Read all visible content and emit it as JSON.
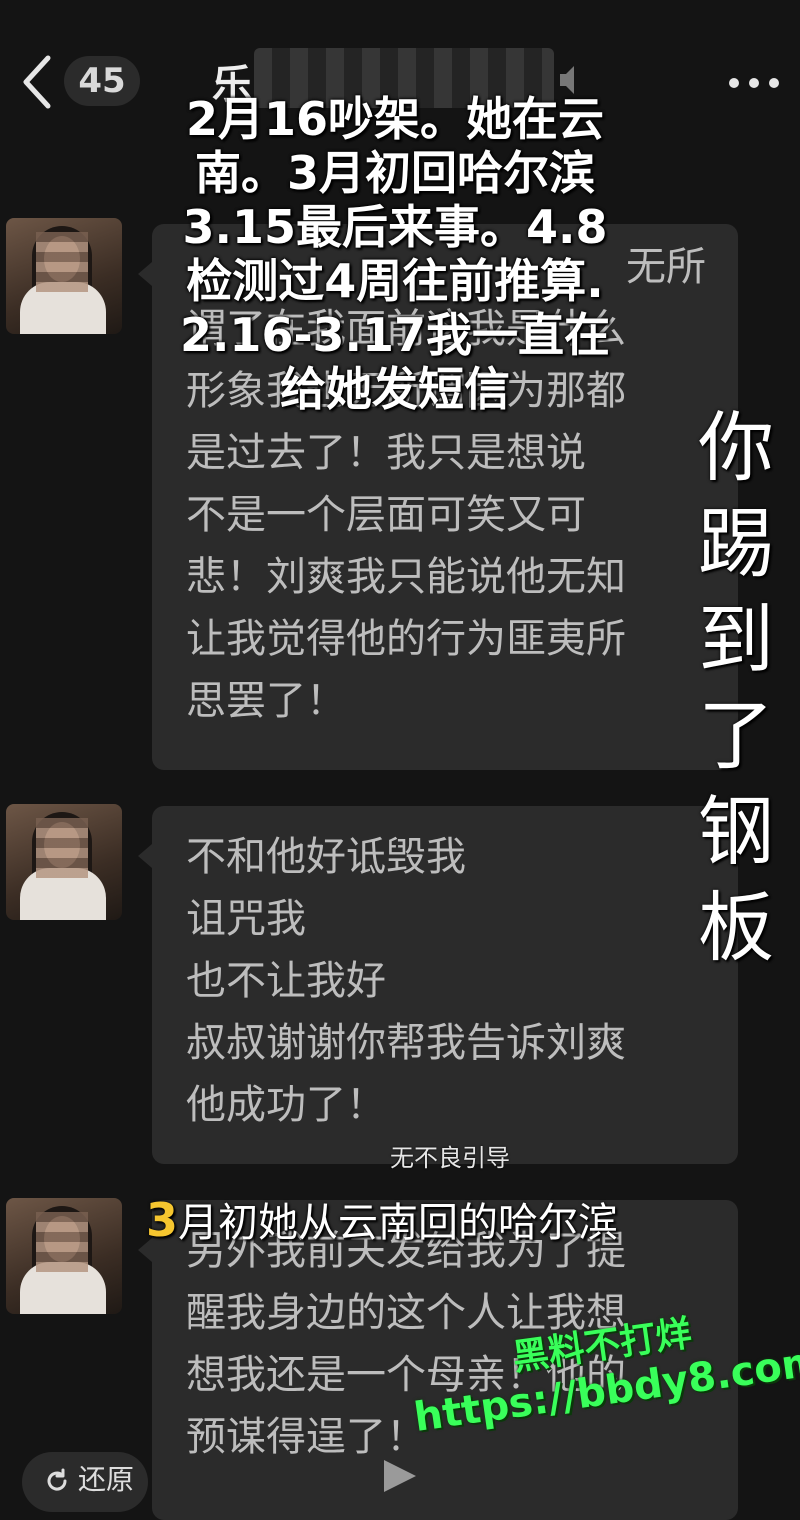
{
  "header": {
    "unread_count": "45",
    "contact_name": "乐"
  },
  "messages": [
    {
      "lines": [
        "",
        "谓了在我面前这我是什么",
        "形象我也无所谓因为那都",
        "是过去了！我只是想说",
        "不是一个层面可笑又可",
        "悲！刘爽我只能说他无知",
        "让我觉得他的行为匪夷所",
        "思罢了！"
      ],
      "partial_line": "无所"
    },
    {
      "lines": [
        "不和他好诋毁我",
        "诅咒我",
        "也不让我好",
        "叔叔谢谢你帮我告诉刘爽",
        "他成功了！"
      ]
    },
    {
      "lines": [
        "另外我前夫发给我为了提",
        "醒我身边的这个人让我想",
        "想我还是一个母亲！他的",
        "预谋得逞了！"
      ]
    }
  ],
  "overlays": {
    "top_caption": [
      "2月16吵架。她在云",
      "南。3月初回哈尔滨",
      "3.15最后来事。4.8",
      "检测过4周往前推算.",
      "2.16-3.17我一直在",
      "给她发短信"
    ],
    "side_caption": [
      "你",
      "踢",
      "到",
      "了",
      "钢",
      "板"
    ],
    "march_caption_num": "3",
    "march_caption_text": "月初她从云南回的哈尔滨",
    "disclaimer": "无不良引导",
    "watermark_line1": "黑料不打烊",
    "watermark_line2": "https://bbdy8.com"
  },
  "footer": {
    "restore_label": "还原"
  }
}
